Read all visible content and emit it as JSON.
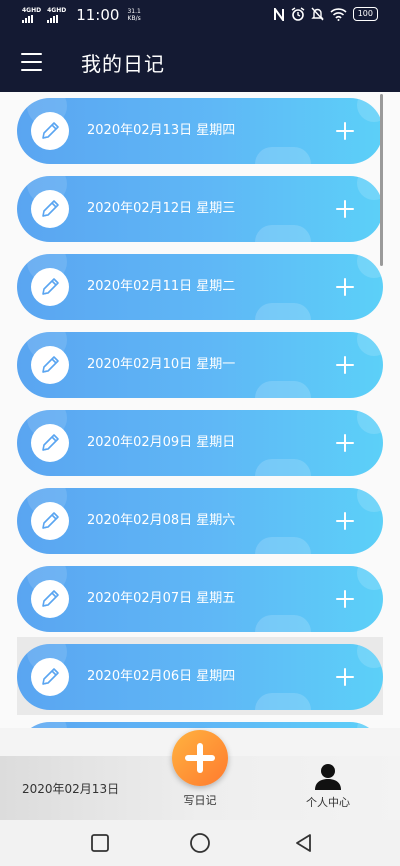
{
  "status": {
    "sim1_label": "4GHD",
    "sim2_label": "4GHD",
    "time": "11:00",
    "speed_value": "31.1",
    "speed_unit": "KB/s",
    "battery": "100"
  },
  "app_bar": {
    "title": "我的日记",
    "menu_icon": "hamburger-menu-icon"
  },
  "diary": {
    "items": [
      {
        "date": "2020年02月13日  星期四"
      },
      {
        "date": "2020年02月12日  星期三"
      },
      {
        "date": "2020年02月11日  星期二"
      },
      {
        "date": "2020年02月10日  星期一"
      },
      {
        "date": "2020年02月09日  星期日"
      },
      {
        "date": "2020年02月08日  星期六"
      },
      {
        "date": "2020年02月07日  星期五"
      },
      {
        "date": "2020年02月06日  星期四"
      },
      {
        "date": ""
      }
    ],
    "item_icon": "pencil-icon",
    "item_action_icon": "plus-icon"
  },
  "bottom_bar": {
    "current_date": "2020年02月13日",
    "write_label": "写日记",
    "profile_label": "个人中心"
  },
  "colors": {
    "header_bg": "#141a33",
    "card_gradient_start": "#5aa5f1",
    "card_gradient_end": "#5cd0f8",
    "fab_start": "#ffb340",
    "fab_end": "#ff7a2e"
  }
}
